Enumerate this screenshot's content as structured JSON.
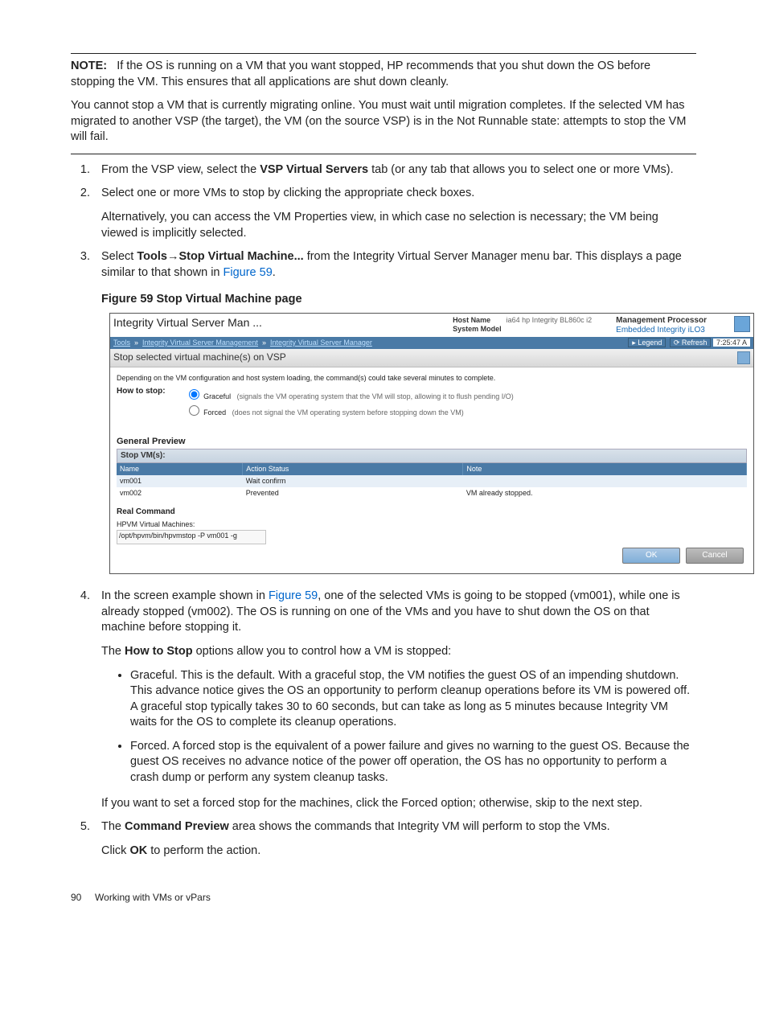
{
  "note": {
    "label": "NOTE:",
    "body1": "If the OS is running on a VM that you want stopped, HP recommends that you shut down the OS before stopping the VM. This ensures that all applications are shut down cleanly.",
    "body2": "You cannot stop a VM that is currently migrating online. You must wait until migration completes. If the selected VM has migrated to another VSP (the target), the VM (on the source VSP) is in the Not Runnable state: attempts to stop the VM will fail."
  },
  "steps": {
    "s1a": "From the VSP view, select the ",
    "s1b": "VSP Virtual Servers",
    "s1c": " tab (or any tab that allows you to select one or more VMs).",
    "s2a": "Select one or more VMs to stop by clicking the appropriate check boxes.",
    "s2b": "Alternatively, you can access the VM Properties view, in which case no selection is necessary; the VM being viewed is implicitly selected.",
    "s3a": "Select ",
    "s3b": "Tools",
    "s3arrow": "→",
    "s3c": "Stop Virtual Machine...",
    "s3d": " from the Integrity Virtual Server Manager menu bar. This displays a page similar to that shown in ",
    "s3e": "Figure 59",
    "s3f": ".",
    "s4a": "In the screen example shown in ",
    "s4b": "Figure 59",
    "s4c": ", one of the selected VMs is going to be stopped (vm001), while one is already stopped (vm002). The OS is running on one of the VMs and you have to shut down the OS on that machine before stopping it.",
    "s4d": "The ",
    "s4e": "How to Stop",
    "s4f": " options allow you to control how a VM is stopped:",
    "bullet1": "Graceful. This is the default. With a graceful stop, the VM notifies the guest OS of an impending shutdown. This advance notice gives the OS an opportunity to perform cleanup operations before its VM is powered off. A graceful stop typically takes 30 to 60 seconds, but can take as long as 5 minutes because Integrity VM waits for the OS to complete its cleanup operations.",
    "bullet2": "Forced. A forced stop is the equivalent of a power failure and gives no warning to the guest OS. Because the guest OS receives no advance notice of the power off operation, the OS has no opportunity to perform a crash dump or perform any system cleanup tasks.",
    "s4g": "If you want to set a forced stop for the machines, click the Forced option; otherwise, skip to the next step.",
    "s5a": "The ",
    "s5b": "Command Preview",
    "s5c": " area shows the commands that Integrity VM will perform to stop the VMs.",
    "s5d": "Click ",
    "s5e": "OK",
    "s5f": " to perform the action."
  },
  "figure_title": "Figure 59 Stop Virtual Machine page",
  "shot": {
    "title": "Integrity Virtual Server Man ...",
    "host_name_lbl": "Host Name",
    "host_name_val": "",
    "sys_model_lbl": "System Model",
    "sys_model_val": "ia64 hp Integrity BL860c i2",
    "mp_lbl": "Management Processor",
    "mp_link": "Embedded Integrity iLO3",
    "breadcrumb_tools": "Tools",
    "breadcrumb_ivsm": "Integrity Virtual Server Management",
    "breadcrumb_ivsmgr": "Integrity Virtual Server Manager",
    "legend": "Legend",
    "refresh": "Refresh",
    "time": "7:25:47 A",
    "panel_title": "Stop selected virtual machine(s) on VSP",
    "depending": "Depending on the VM configuration and host system loading, the command(s) could take several minutes to complete.",
    "how_lbl": "How to stop:",
    "opt_graceful": "Graceful",
    "opt_graceful_d": "(signals the VM operating system that the VM will stop, allowing it to flush pending I/O)",
    "opt_forced": "Forced",
    "opt_forced_d": "(does not signal the VM operating system before stopping down the VM)",
    "general_preview": "General Preview",
    "stop_vms": "Stop VM(s):",
    "th_name": "Name",
    "th_action": "Action Status",
    "th_note": "Note",
    "rows": [
      {
        "name": "vm001",
        "status": "Wait confirm",
        "note": ""
      },
      {
        "name": "vm002",
        "status": "Prevented",
        "note": "VM already stopped."
      }
    ],
    "real_command": "Real Command",
    "hpvm_vm": "HPVM Virtual Machines:",
    "cmd": "/opt/hpvm/bin/hpvmstop -P vm001 -g",
    "ok": "OK",
    "cancel": "Cancel"
  },
  "footer": {
    "page": "90",
    "section": "Working with VMs or vPars"
  }
}
